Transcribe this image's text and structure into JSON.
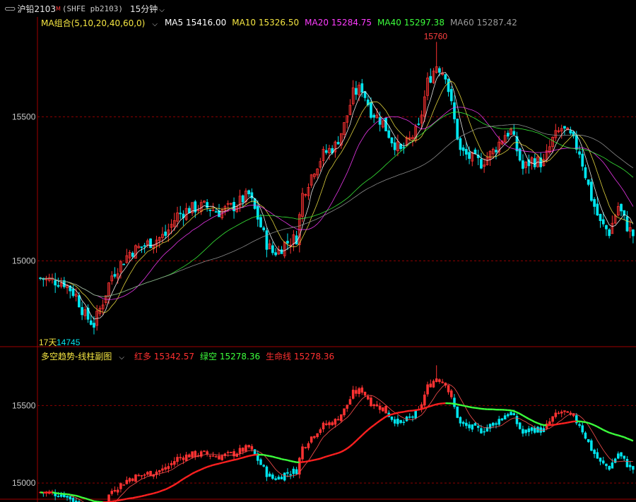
{
  "window": {
    "symbol": "沪铅2103",
    "flag": "M",
    "code": "(SHFE pb2103)",
    "period": "15分钟"
  },
  "main_legend": {
    "group_label": "MA组合(5,10,20,40,60,0)",
    "items": [
      {
        "label": "MA5 15416.00",
        "color": "#ffffff"
      },
      {
        "label": "MA10 15326.50",
        "color": "#f5e642"
      },
      {
        "label": "MA20 15284.75",
        "color": "#ff3cff"
      },
      {
        "label": "MA40 15297.38",
        "color": "#3cff3c"
      },
      {
        "label": "MA60 15287.42",
        "color": "#9a9a9a"
      }
    ]
  },
  "sub_legend": {
    "group_label": "多空趋势-线柱副图",
    "items": [
      {
        "label": "红多 15342.57",
        "color": "#ff3030"
      },
      {
        "label": "绿空 15278.36",
        "color": "#3cff3c"
      },
      {
        "label": "生命线 15278.36",
        "color": "#ff3030"
      }
    ]
  },
  "annotations": {
    "high_label": "15760",
    "low_label": "14745",
    "days_label": "17天"
  },
  "colors": {
    "up": "#ff3232",
    "down": "#00e5ee",
    "grid": "#8b0000",
    "frame": "#a00000",
    "ma5": "#ffffff",
    "ma10": "#f5e642",
    "ma20": "#ff3cff",
    "ma40": "#3cff3c",
    "ma60": "#9a9a9a",
    "sub_short": "#ff5050",
    "sub_life_up": "#ff2020",
    "sub_life_down": "#3cff3c"
  },
  "chart_data": [
    {
      "type": "candlestick",
      "name": "main",
      "y_ticks": [
        15000,
        15500
      ],
      "ylim": [
        14700,
        15800
      ],
      "high": 15760,
      "low": 14745,
      "bars": 200,
      "ma_periods": [
        5,
        10,
        20,
        40,
        60
      ],
      "close_path": [
        [
          0,
          14940
        ],
        [
          8,
          14925
        ],
        [
          12,
          14880
        ],
        [
          15,
          14810
        ],
        [
          18,
          14780
        ],
        [
          21,
          14860
        ],
        [
          24,
          14950
        ],
        [
          30,
          15030
        ],
        [
          36,
          15060
        ],
        [
          42,
          15090
        ],
        [
          46,
          15160
        ],
        [
          50,
          15180
        ],
        [
          55,
          15190
        ],
        [
          60,
          15170
        ],
        [
          65,
          15190
        ],
        [
          70,
          15230
        ],
        [
          73,
          15150
        ],
        [
          76,
          15060
        ],
        [
          78,
          15030
        ],
        [
          80,
          15035
        ],
        [
          82,
          15060
        ],
        [
          86,
          15080
        ],
        [
          88,
          15230
        ],
        [
          92,
          15320
        ],
        [
          95,
          15370
        ],
        [
          99,
          15400
        ],
        [
          102,
          15470
        ],
        [
          105,
          15580
        ],
        [
          108,
          15600
        ],
        [
          111,
          15520
        ],
        [
          115,
          15480
        ],
        [
          118,
          15420
        ],
        [
          121,
          15380
        ],
        [
          124,
          15420
        ],
        [
          127,
          15460
        ],
        [
          130,
          15620
        ],
        [
          133,
          15680
        ],
        [
          136,
          15650
        ],
        [
          138,
          15540
        ],
        [
          141,
          15380
        ],
        [
          144,
          15360
        ],
        [
          148,
          15340
        ],
        [
          152,
          15380
        ],
        [
          156,
          15440
        ],
        [
          158,
          15450
        ],
        [
          162,
          15320
        ],
        [
          165,
          15350
        ],
        [
          169,
          15340
        ],
        [
          172,
          15420
        ],
        [
          175,
          15460
        ],
        [
          178,
          15430
        ],
        [
          181,
          15380
        ],
        [
          185,
          15220
        ],
        [
          188,
          15130
        ],
        [
          191,
          15100
        ],
        [
          194,
          15190
        ],
        [
          197,
          15120
        ],
        [
          199,
          15090
        ]
      ]
    },
    {
      "type": "line",
      "name": "sub",
      "y_ticks": [
        15000,
        15500
      ],
      "ylim": [
        14900,
        15780
      ],
      "series": [
        {
          "name": "红多",
          "value": 15342.57
        },
        {
          "name": "绿空",
          "value": 15278.36
        },
        {
          "name": "生命线",
          "value": 15278.36
        }
      ]
    }
  ]
}
